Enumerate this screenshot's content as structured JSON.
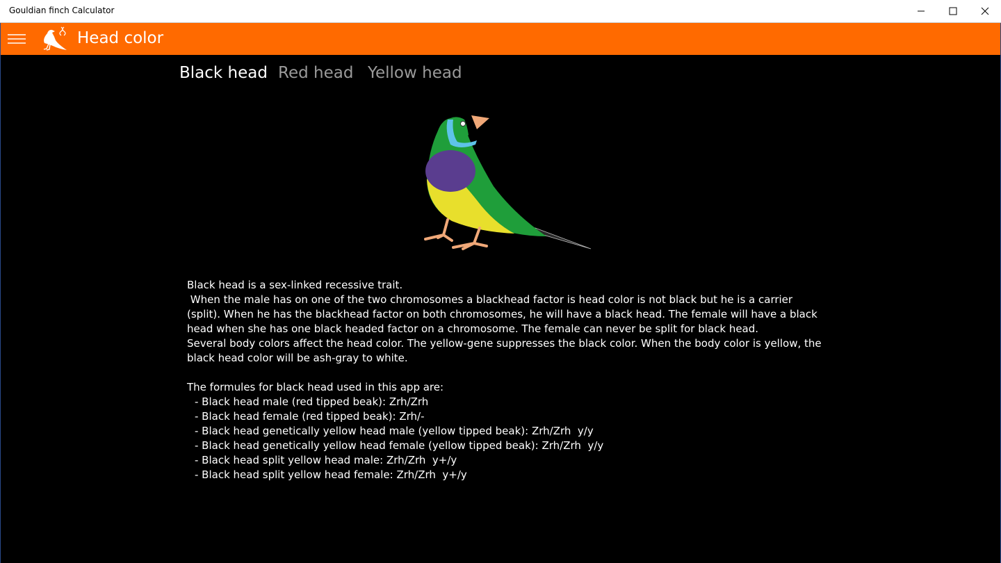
{
  "window": {
    "title": "Gouldian finch Calculator"
  },
  "appbar": {
    "page_title": "Head color"
  },
  "tabs": [
    {
      "label": "Black head",
      "active": true
    },
    {
      "label": "Red head",
      "active": false
    },
    {
      "label": "Yellow head",
      "active": false
    }
  ],
  "content": {
    "paragraphs": [
      "Black head is a sex-linked recessive trait.",
      " When the male has on one of the two chromosomes a blackhead factor is head color is not black but he is a carrier (split). When he has the blackhead factor on both chromosomes, he will have a black head. The female will have a black head when she has one black headed factor on a chromosome. The female can never be split for black head.",
      "Several body colors affect the head color. The yellow-gene suppresses the black color. When the body color is yellow, the black head color will be ash-gray to white."
    ],
    "formulas_heading": "The formules for black head used in this app are:",
    "formulas": [
      "- Black head male (red tipped beak): Zrh/Zrh",
      "- Black head female (red tipped beak): Zrh/-",
      "- Black head genetically yellow head male (yellow tipped beak): Zrh/Zrh  y/y",
      "- Black head genetically yellow head female (yellow tipped beak): Zrh/Zrh  y/y",
      "- Black head split yellow head male: Zrh/Zrh  y+/y",
      "- Black head split yellow head female: Zrh/Zrh  y+/y"
    ]
  },
  "colors": {
    "accent": "#ff6a00",
    "background": "#000000",
    "bird_green": "#1f9e3a",
    "bird_purple": "#5a3d8f",
    "bird_yellow": "#e8df2c",
    "bird_cyan": "#5ec3e8",
    "bird_beak": "#f0a878"
  },
  "icons": {
    "menu": "hamburger-icon",
    "logo": "finch-logo-icon",
    "minimize": "minimize-icon",
    "maximize": "maximize-icon",
    "close": "close-icon"
  }
}
